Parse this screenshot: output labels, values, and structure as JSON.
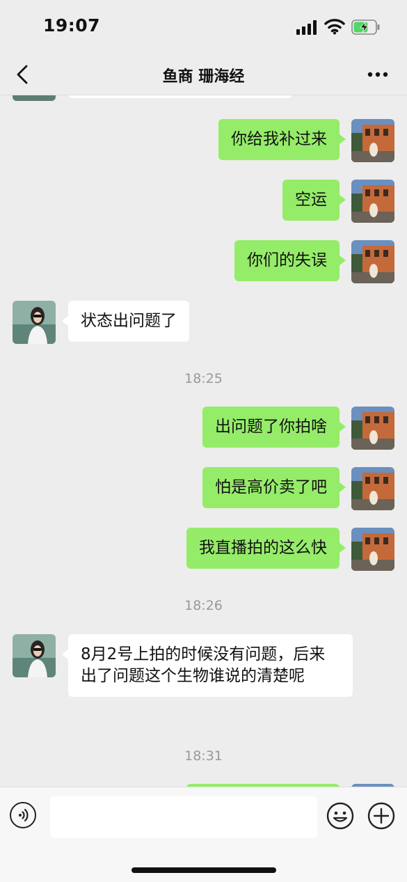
{
  "status_bar": {
    "time": "19:07"
  },
  "header": {
    "title": "鱼商 珊海经"
  },
  "messages": [
    {
      "id": "m0",
      "from": "them",
      "text": ""
    },
    {
      "id": "m1",
      "from": "me",
      "text": "你给我补过来"
    },
    {
      "id": "m2",
      "from": "me",
      "text": "空运"
    },
    {
      "id": "m3",
      "from": "me",
      "text": "你们的失误"
    },
    {
      "id": "m4",
      "from": "them",
      "text": "状态出问题了"
    },
    {
      "id": "t1",
      "type": "timestamp",
      "text": "18:25"
    },
    {
      "id": "m5",
      "from": "me",
      "text": "出问题了你拍啥"
    },
    {
      "id": "m6",
      "from": "me",
      "text": "怕是高价卖了吧"
    },
    {
      "id": "m7",
      "from": "me",
      "text": "我直播拍的这么快"
    },
    {
      "id": "t2",
      "type": "timestamp",
      "text": "18:26"
    },
    {
      "id": "m8",
      "from": "them",
      "text": "8月2号上拍的时候没有问题，后来出了问题这个生物谁说的清楚呢"
    },
    {
      "id": "t3",
      "type": "timestamp",
      "text": "18:31"
    },
    {
      "id": "m9",
      "from": "me",
      "text": ""
    }
  ],
  "input": {
    "value": ""
  },
  "icons": {
    "back": "chevron-left-icon",
    "more": "more-dots-icon",
    "voice": "voice-icon",
    "emoji": "emoji-icon",
    "plus": "plus-icon"
  },
  "colors": {
    "my_bubble": "#95ec69",
    "their_bubble": "#ffffff",
    "background": "#ededed"
  }
}
